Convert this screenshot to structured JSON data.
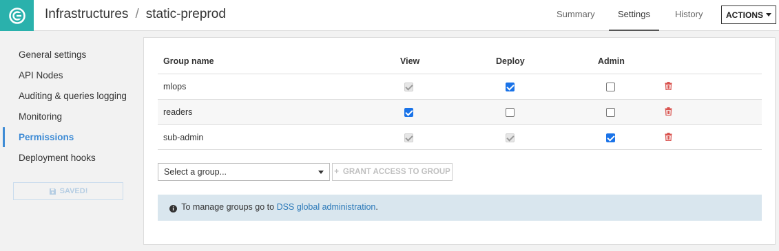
{
  "header": {
    "breadcrumb_root": "Infrastructures",
    "breadcrumb_sep": "/",
    "breadcrumb_current": "static-preprod",
    "tabs": [
      {
        "label": "Summary"
      },
      {
        "label": "Settings"
      },
      {
        "label": "History"
      }
    ],
    "active_tab": "Settings",
    "actions_label": "ACTIONS"
  },
  "sidebar": {
    "items": [
      {
        "label": "General settings"
      },
      {
        "label": "API Nodes"
      },
      {
        "label": "Auditing & queries logging"
      },
      {
        "label": "Monitoring"
      },
      {
        "label": "Permissions"
      },
      {
        "label": "Deployment hooks"
      }
    ],
    "active_item": "Permissions",
    "saved_label": "SAVED!"
  },
  "permissions": {
    "columns": {
      "group": "Group name",
      "view": "View",
      "deploy": "Deploy",
      "admin": "Admin"
    },
    "rows": [
      {
        "name": "mlops",
        "view": true,
        "view_disabled": true,
        "deploy": true,
        "deploy_disabled": false,
        "admin": false,
        "admin_disabled": false
      },
      {
        "name": "readers",
        "view": true,
        "view_disabled": false,
        "deploy": false,
        "deploy_disabled": false,
        "admin": false,
        "admin_disabled": false
      },
      {
        "name": "sub-admin",
        "view": true,
        "view_disabled": true,
        "deploy": true,
        "deploy_disabled": true,
        "admin": true,
        "admin_disabled": false
      }
    ],
    "select_placeholder": "Select a group...",
    "grant_label": "GRANT ACCESS TO GROUP",
    "grant_icon": "+",
    "info_text": "To manage groups go to",
    "info_link": "DSS global administration",
    "info_suffix": "."
  },
  "colors": {
    "brand": "#2ab1ac",
    "accent": "#3d8bd5",
    "delete": "#d9534f",
    "checkbox": "#1a73e8",
    "info_bg": "#d9e6ee"
  }
}
